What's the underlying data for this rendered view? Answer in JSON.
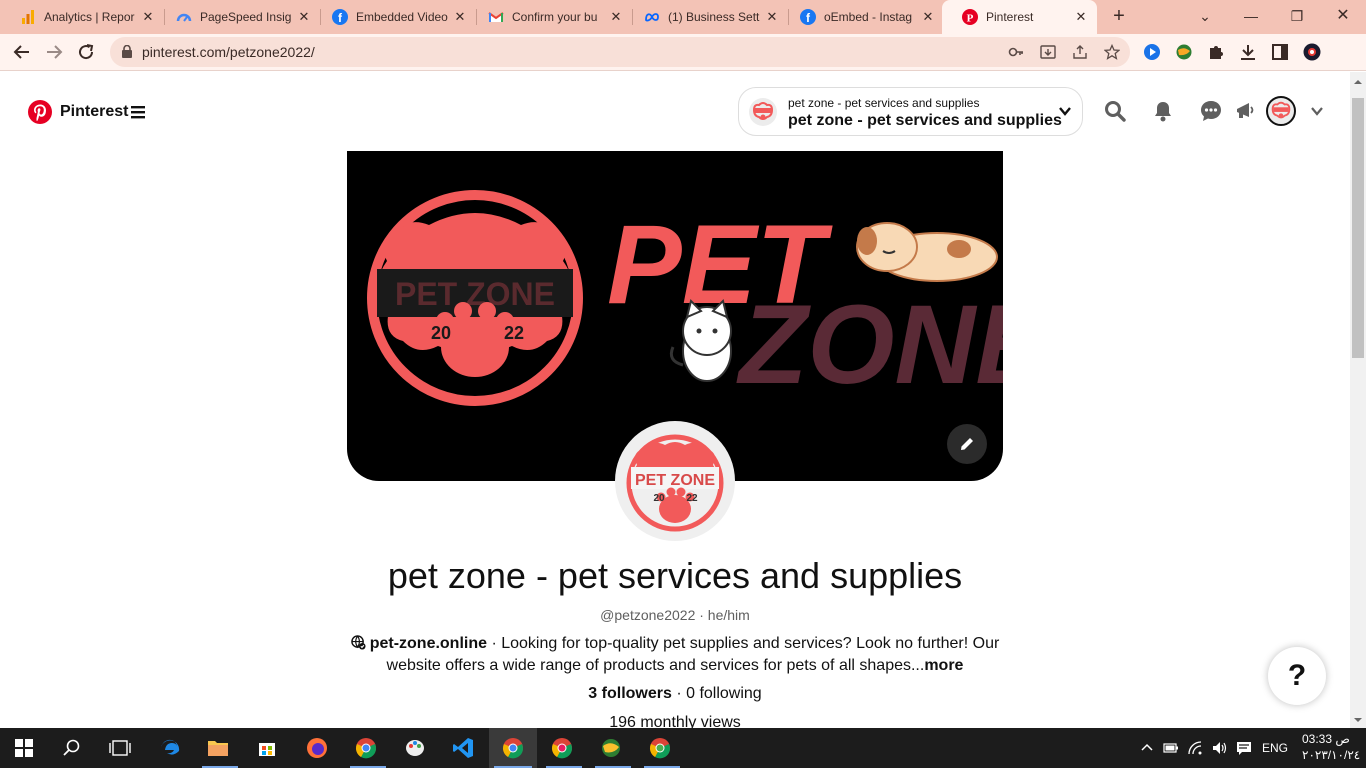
{
  "browser": {
    "tabs": [
      {
        "title": "Analytics | Repor",
        "icon": "analytics-icon"
      },
      {
        "title": "PageSpeed Insig",
        "icon": "pagespeed-icon"
      },
      {
        "title": "Embedded Video",
        "icon": "facebook-icon"
      },
      {
        "title": "Confirm your bu",
        "icon": "gmail-icon"
      },
      {
        "title": "(1) Business Sett",
        "icon": "meta-icon"
      },
      {
        "title": "oEmbed - Instag",
        "icon": "facebook-icon"
      },
      {
        "title": "Pinterest",
        "icon": "pinterest-icon"
      }
    ],
    "active_tab": 6,
    "url": "pinterest.com/petzone2022/"
  },
  "header": {
    "brand": "Pinterest",
    "account_sub": "pet zone - pet services and supplies",
    "account_main": "pet zone - pet services and supplies"
  },
  "profile": {
    "avatar_text": "PET ZONE",
    "avatar_year_left": "20",
    "avatar_year_right": "22",
    "cover_title_1": "PET",
    "cover_title_2": "ZONE",
    "cover_badge_text": "PET ZONE",
    "cover_badge_year_left": "20",
    "cover_badge_year_right": "22",
    "name": "pet zone - pet services and supplies",
    "handle": "@petzone2022 · he/him",
    "website": "pet-zone.online",
    "bio": " · Looking for top-quality pet supplies and services? Look no further! Our website offers a wide range of products and services for pets of all shapes...",
    "more": "more",
    "followers": "3 followers",
    "following": " · 0 following",
    "monthly_views": "196 monthly views",
    "help": "?"
  },
  "taskbar": {
    "language": "ENG",
    "time": "03:33 ص",
    "date": "٢٠٢٣/١٠/٢٤"
  },
  "colors": {
    "pinterest_red": "#e60023",
    "brand_coral": "#f25a5a",
    "tab_strip": "#f3c3b6"
  }
}
